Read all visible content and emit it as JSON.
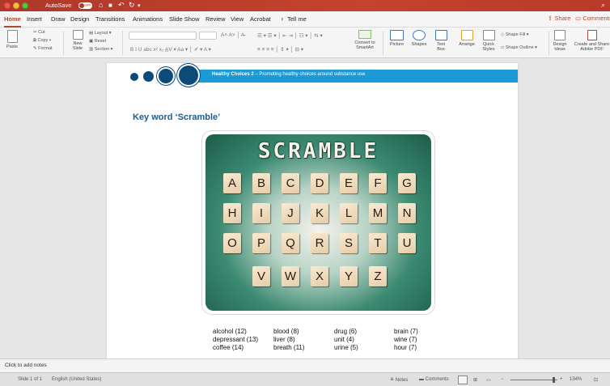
{
  "titlebar": {
    "autosave_label": "AutoSave",
    "autosave_state": "OFF",
    "home_icon": "home-icon",
    "save_icon": "save-icon",
    "undo_icon": "undo-icon",
    "redo_icon": "redo-icon",
    "accent_color": "#b7472a"
  },
  "tabs": [
    "Home",
    "Insert",
    "Draw",
    "Design",
    "Transitions",
    "Animations",
    "Slide Show",
    "Review",
    "View",
    "Acrobat"
  ],
  "tell_me": "Tell me",
  "share_label": "Share",
  "comments_label": "Comments",
  "ribbon": {
    "paste": "Paste",
    "cut": "Cut",
    "copy": "Copy",
    "format": "Format",
    "new_slide": [
      "New",
      "Slide"
    ],
    "layout": "Layout",
    "reset": "Reset",
    "section": "Section",
    "convert": [
      "Convert to",
      "SmartArt"
    ],
    "picture": "Picture",
    "shapes": "Shapes",
    "text_box": [
      "Text",
      "Box"
    ],
    "arrange": "Arrange",
    "quick_styles": [
      "Quick",
      "Styles"
    ],
    "shape_fill": "Shape Fill",
    "shape_outline": "Shape Outline",
    "design_ideas": [
      "Design",
      "Ideas"
    ],
    "create_share": [
      "Create and Share",
      "Adobe PDF"
    ]
  },
  "slide": {
    "banner_bold": "Healthy Choices 2",
    "banner_rest": " – Promoting healthy choices around substance use",
    "title": "Key word ‘Scramble’",
    "scramble_title": "SCRAMBLE",
    "tile_rows": [
      [
        "A",
        "B",
        "C",
        "D",
        "E",
        "F",
        "G"
      ],
      [
        "H",
        "I",
        "J",
        "K",
        "L",
        "M",
        "N"
      ],
      [
        "O",
        "P",
        "Q",
        "R",
        "S",
        "T",
        "U"
      ],
      [
        "V",
        "W",
        "X",
        "Y",
        "Z"
      ]
    ],
    "words": [
      [
        "alcohol (12)",
        "depressant (13)",
        "coffee (14)"
      ],
      [
        "blood (8)",
        "liver (8)",
        "breath (11)"
      ],
      [
        "drug (6)",
        "unit (4)",
        "urine (5)"
      ],
      [
        "brain (7)",
        "wine (7)",
        "hour (7)"
      ]
    ]
  },
  "notes_placeholder": "Click to add notes",
  "status": {
    "slide": "Slide 1 of 1",
    "language": "English (United States)",
    "notes": "Notes",
    "comments": "Comments",
    "zoom": "134%"
  }
}
